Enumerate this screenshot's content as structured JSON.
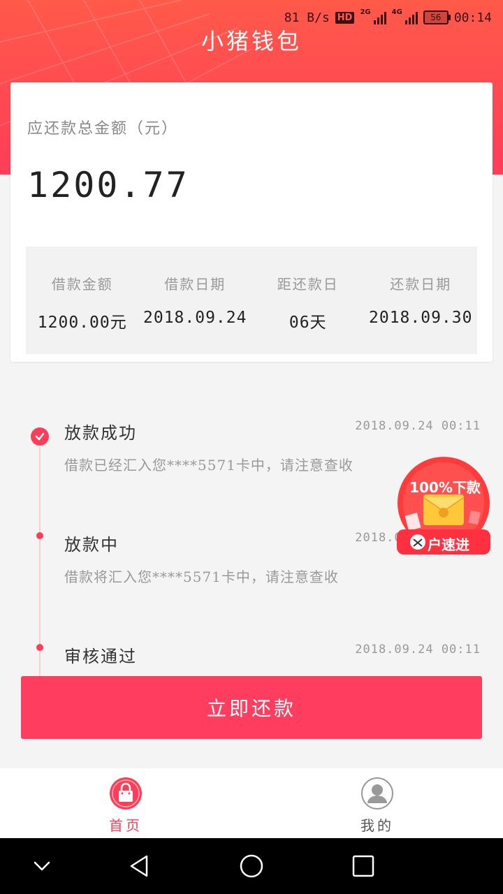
{
  "status_bar": {
    "speed": "81 B/s",
    "hd": "HD",
    "network_1": "2G",
    "network_2": "4G",
    "battery": "56",
    "time": "00:14"
  },
  "app": {
    "title": "小猪钱包"
  },
  "summary": {
    "label": "应还款总金额（元）",
    "amount": "1200.77",
    "details": [
      {
        "label": "借款金额",
        "value": "1200.00元"
      },
      {
        "label": "借款日期",
        "value": "2018.09.24"
      },
      {
        "label": "距还款日",
        "value": "06天"
      },
      {
        "label": "还款日期",
        "value": "2018.09.30"
      }
    ]
  },
  "timeline": [
    {
      "title": "放款成功",
      "time": "2018.09.24 00:11",
      "desc": "借款已经汇入您****5571卡中，请注意查收",
      "done": true
    },
    {
      "title": "放款中",
      "time": "2018.09.24 00:11",
      "desc": "借款将汇入您****5571卡中，请注意查收",
      "done": false
    },
    {
      "title": "审核通过",
      "time": "2018.09.24 00:11",
      "desc": "",
      "done": false
    }
  ],
  "ad": {
    "headline": "100%下款",
    "subline": "户速进"
  },
  "actions": {
    "repay_label": "立即还款"
  },
  "tabs": [
    {
      "label": "首页",
      "icon": "shopping-bag-icon",
      "active": true
    },
    {
      "label": "我的",
      "icon": "user-profile-icon",
      "active": false
    }
  ],
  "nav_bar": {
    "icons": [
      "back-chevron-icon",
      "triangle-back-icon",
      "home-circle-icon",
      "recents-square-icon"
    ]
  },
  "colors": {
    "brand": "#ff3d58",
    "header_gradient_top": "#ff5a4a",
    "button": "#ff3d5e"
  }
}
